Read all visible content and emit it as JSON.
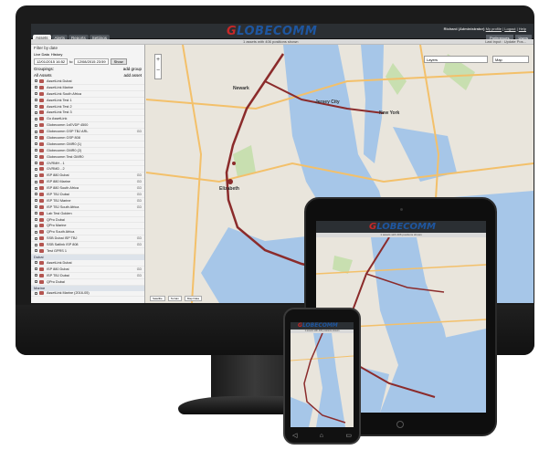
{
  "brand": {
    "logo_first": "G",
    "logo_rest": "LOBECOMM"
  },
  "desktop": {
    "user_prefix": "Richard (Administrator)",
    "user_links": [
      "My profile",
      "Logout",
      "Help"
    ],
    "tabs": [
      "Assets",
      "Alerts",
      "Reports",
      "Settings"
    ],
    "active_tab": "Assets",
    "right_buttons": [
      "Preferences",
      "Users"
    ],
    "subheader": "1 assets with 406 positions shown",
    "subheader_right": "Last input : Update Pos...",
    "sidebar": {
      "filter_label": "Filter by date",
      "live_data": "Live Data",
      "history": "History",
      "date_from": "12/01/2015 16:52",
      "date_to": "12/08/2015 23:59",
      "show_button": "Show",
      "groupings_label": "Groupings:",
      "add_group": "add group",
      "all_assets": "All Assets",
      "add_asset": "add asset",
      "items": [
        {
          "name": "AssetLink Dubai",
          "count": ""
        },
        {
          "name": "AssetLink Marine",
          "count": ""
        },
        {
          "name": "AssetLink South Africa",
          "count": ""
        },
        {
          "name": "AssetLink Test 1",
          "count": ""
        },
        {
          "name": "AssetLink Test 2",
          "count": ""
        },
        {
          "name": "AssetLink Test 3",
          "count": ""
        },
        {
          "name": "Go AssetLink",
          "count": ""
        },
        {
          "name": "Globecomm 1xEVDP 4500",
          "count": ""
        },
        {
          "name": "Globecomm GSP TBJ ARL",
          "count": "GD"
        },
        {
          "name": "Globecomm GSP 808",
          "count": ""
        },
        {
          "name": "Globecomm GMR0 (1)",
          "count": ""
        },
        {
          "name": "Globecomm GMR0 (2)",
          "count": ""
        },
        {
          "name": "Globecomm Test GMR0",
          "count": ""
        },
        {
          "name": "GVRMH - 1",
          "count": ""
        },
        {
          "name": "GVRMD - 2",
          "count": ""
        },
        {
          "name": "ISP 880 Dubai",
          "count": "GD"
        },
        {
          "name": "ISP 880 Marine",
          "count": "GD"
        },
        {
          "name": "ISP 880 South Africa",
          "count": "GD"
        },
        {
          "name": "ISP TBJ Dubai",
          "count": "GD"
        },
        {
          "name": "ISP TBJ Marine",
          "count": "GD"
        },
        {
          "name": "ISP TBJ South Africa",
          "count": "GD"
        },
        {
          "name": "Lab Test Golden",
          "count": ""
        },
        {
          "name": "QPro Dubai",
          "count": ""
        },
        {
          "name": "QPro Marine",
          "count": ""
        },
        {
          "name": "QPro South Africa",
          "count": ""
        },
        {
          "name": "SSB Dubai ISP TBJ",
          "count": "GD"
        },
        {
          "name": "SSB Satlink ISP 808",
          "count": "GD"
        },
        {
          "name": "Test GPRS 1",
          "count": ""
        }
      ],
      "group_dubai": "Dubai",
      "dubai_items": [
        {
          "name": "AssetLink Dubai",
          "count": ""
        },
        {
          "name": "ISP 880 Dubai",
          "count": "GD"
        },
        {
          "name": "ISP TBJ Dubai",
          "count": "GD"
        },
        {
          "name": "QPro Dubai",
          "count": ""
        }
      ],
      "group_marine": "Marine",
      "marine_items": [
        {
          "name": "AssetLink Marine (2016-05)",
          "count": ""
        }
      ]
    },
    "map": {
      "search_placeholder": "Layers",
      "search2_placeholder": "Map",
      "zoom_in": "+",
      "zoom_out": "−",
      "labels": [
        "Newark",
        "Jersey City",
        "New York",
        "Elizabeth"
      ],
      "footer": [
        "Satellite",
        "Terrain",
        "Map Data"
      ]
    }
  },
  "tablet": {
    "subheader": "1 assets with 406 positions shown"
  },
  "phone": {
    "subheader": "1 assets with 406 positions shown",
    "nav": [
      "◁",
      "⌂",
      "▭"
    ]
  },
  "colors": {
    "water": "#a6c6e8",
    "land": "#e9e5dc",
    "park": "#c8dfb0",
    "highway": "#f3c06a",
    "track": "#8b2b2b",
    "brand_red": "#c62828",
    "brand_blue": "#1e56a0"
  }
}
